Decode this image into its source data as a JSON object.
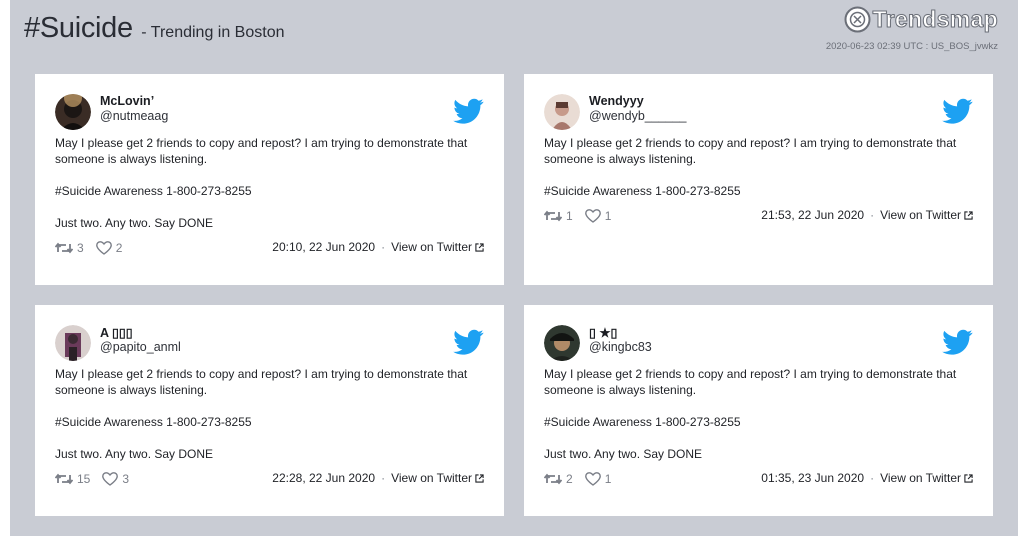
{
  "header": {
    "hashtag": "#Suicide",
    "subtitle": "- Trending in Boston",
    "brand": "Trendsmap",
    "meta": "2020-06-23 02:39 UTC : US_BOS_jvwkz"
  },
  "tweets": [
    {
      "name": "McLovin’",
      "handle": "@nutmeaag",
      "lines": [
        "May I please get 2 friends to copy and repost? I am trying to demonstrate that someone is always listening.",
        "#Suicide Awareness 1-800-273-8255",
        "Just two. Any two. Say DONE"
      ],
      "retweets": "3",
      "likes": "2",
      "time": "20:10, 22 Jun 2020",
      "view": "View on Twitter"
    },
    {
      "name": "Wendyyy",
      "handle": "@wendyb______",
      "lines": [
        "May I please get 2 friends to copy and repost? I am trying to demonstrate that someone is always listening.",
        "#Suicide Awareness 1-800-273-8255"
      ],
      "retweets": "1",
      "likes": "1",
      "time": "21:53, 22 Jun 2020",
      "view": "View on Twitter"
    },
    {
      "name": "A ▯▯▯",
      "handle": "@papito_anml",
      "lines": [
        "May I please get 2 friends to copy and repost? I am trying to demonstrate that someone is always listening.",
        "#Suicide Awareness 1-800-273-8255",
        "Just two. Any two. Say DONE"
      ],
      "retweets": "15",
      "likes": "3",
      "time": "22:28, 22 Jun 2020",
      "view": "View on Twitter"
    },
    {
      "name": "▯ ★▯",
      "handle": "@kingbc83",
      "lines": [
        "May I please get 2 friends to copy and repost? I am trying to demonstrate that someone is always listening.",
        "#Suicide Awareness 1-800-273-8255",
        "Just two. Any two. Say DONE"
      ],
      "retweets": "2",
      "likes": "1",
      "time": "01:35, 23 Jun 2020",
      "view": "View on Twitter"
    }
  ],
  "colors": {
    "background": "#c9ccd4",
    "card": "#ffffff",
    "twitter_blue": "#1da1f2",
    "muted": "#7a7e87"
  },
  "icons": {
    "brand": "trendsmap-logo-icon",
    "bird": "twitter-bird-icon",
    "retweet": "retweet-icon",
    "like": "heart-icon",
    "external": "external-link-icon"
  }
}
